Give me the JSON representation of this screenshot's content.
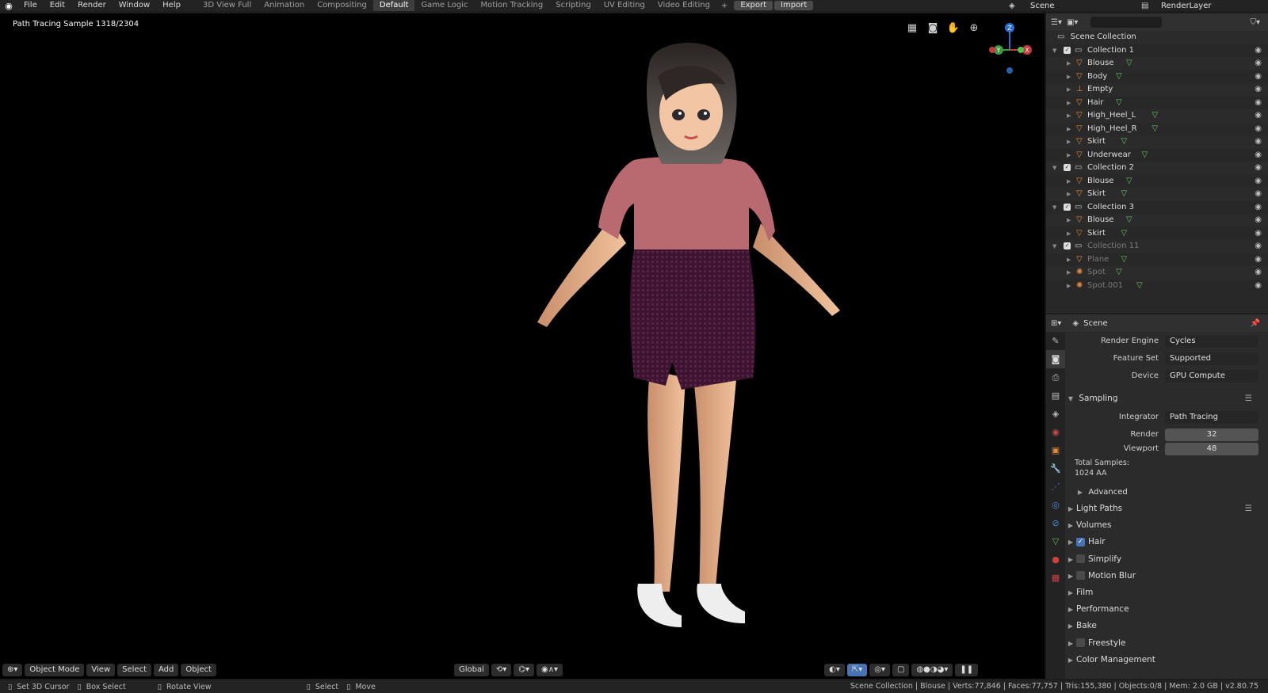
{
  "menus": [
    "File",
    "Edit",
    "Render",
    "Window",
    "Help"
  ],
  "workspaces": [
    "3D View Full",
    "Animation",
    "Compositing",
    "Default",
    "Game Logic",
    "Motion Tracking",
    "Scripting",
    "UV Editing",
    "Video Editing"
  ],
  "active_workspace": "Default",
  "toolbar": {
    "export": "Export",
    "import": "Import",
    "scene": "Scene",
    "renderlayer": "RenderLayer",
    "add_ws": "+"
  },
  "viewport": {
    "sample_label": "Path Tracing Sample 1318/2304",
    "mode": "Object Mode",
    "menus": [
      "View",
      "Select",
      "Add",
      "Object"
    ],
    "orientation": "Global"
  },
  "gizmo": {
    "z": "Z",
    "y": "Y",
    "x": "X"
  },
  "outliner": {
    "title": "Scene Collection",
    "rows": [
      {
        "name": "Collection 1",
        "level": 1,
        "type": "collection"
      },
      {
        "name": "Blouse",
        "level": 2,
        "type": "mesh"
      },
      {
        "name": "Body",
        "level": 2,
        "type": "mesh"
      },
      {
        "name": "Empty",
        "level": 2,
        "type": "empty"
      },
      {
        "name": "Hair",
        "level": 2,
        "type": "mesh"
      },
      {
        "name": "High_Heel_L",
        "level": 2,
        "type": "mesh"
      },
      {
        "name": "High_Heel_R",
        "level": 2,
        "type": "mesh"
      },
      {
        "name": "Skirt",
        "level": 2,
        "type": "mesh"
      },
      {
        "name": "Underwear",
        "level": 2,
        "type": "mesh"
      },
      {
        "name": "Collection 2",
        "level": 1,
        "type": "collection"
      },
      {
        "name": "Blouse",
        "level": 2,
        "type": "mesh"
      },
      {
        "name": "Skirt",
        "level": 2,
        "type": "mesh"
      },
      {
        "name": "Collection 3",
        "level": 1,
        "type": "collection"
      },
      {
        "name": "Blouse",
        "level": 2,
        "type": "mesh"
      },
      {
        "name": "Skirt",
        "level": 2,
        "type": "mesh"
      },
      {
        "name": "Collection 11",
        "level": 1,
        "type": "collection",
        "dim": true
      },
      {
        "name": "Plane",
        "level": 2,
        "type": "mesh",
        "dim": true
      },
      {
        "name": "Spot",
        "level": 2,
        "type": "light",
        "dim": true
      },
      {
        "name": "Spot.001",
        "level": 2,
        "type": "light",
        "dim": true
      }
    ]
  },
  "properties": {
    "context": "Scene",
    "render_engine_label": "Render Engine",
    "render_engine": "Cycles",
    "feature_set_label": "Feature Set",
    "feature_set": "Supported",
    "device_label": "Device",
    "device": "GPU Compute",
    "sampling": "Sampling",
    "integrator_label": "Integrator",
    "integrator": "Path Tracing",
    "render_label": "Render",
    "render_val": "32",
    "viewport_label": "Viewport",
    "viewport_val": "48",
    "total_label": "Total Samples:",
    "total_val": "1024 AA",
    "advanced": "Advanced",
    "sections": [
      {
        "label": "Light Paths",
        "checkbox": null
      },
      {
        "label": "Volumes",
        "checkbox": null
      },
      {
        "label": "Hair",
        "checkbox": true
      },
      {
        "label": "Simplify",
        "checkbox": false
      },
      {
        "label": "Motion Blur",
        "checkbox": false
      },
      {
        "label": "Film",
        "checkbox": null
      },
      {
        "label": "Performance",
        "checkbox": null
      },
      {
        "label": "Bake",
        "checkbox": null
      },
      {
        "label": "Freestyle",
        "checkbox": false
      },
      {
        "label": "Color Management",
        "checkbox": null
      }
    ]
  },
  "status": {
    "left": [
      "Set 3D Cursor",
      "Box Select",
      "Rotate View",
      "Select",
      "Move"
    ],
    "right": "Scene Collection | Blouse | Verts:77,846 | Faces:77,757 | Tris:155,380 | Objects:0/8 | Mem: 2.0 GB | v2.80.75"
  }
}
